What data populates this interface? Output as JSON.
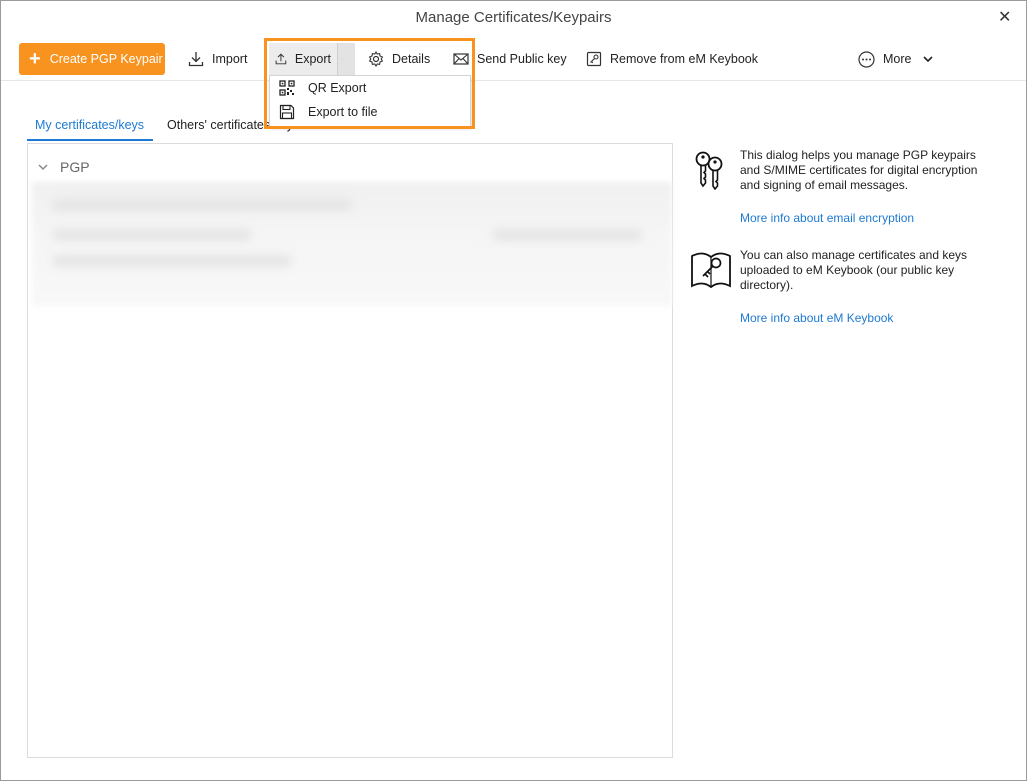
{
  "window": {
    "title": "Manage Certificates/Keypairs",
    "close_label": "✕"
  },
  "toolbar": {
    "create": "Create PGP Keypair",
    "import": "Import",
    "export": "Export",
    "details": "Details",
    "send_public_key": "Send Public key",
    "remove_keybook": "Remove from eM Keybook",
    "more": "More"
  },
  "export_menu": {
    "items": [
      "QR Export",
      "Export to file"
    ]
  },
  "tabs": {
    "mine": "My certificates/keys",
    "others": "Others' certificates/keys"
  },
  "list": {
    "group": "PGP"
  },
  "info": {
    "block1": "This dialog helps you manage PGP keypairs and S/MIME certificates for digital encryption and signing of email messages.",
    "link1": "More info about email encryption",
    "block2": "You can also manage certificates and keys uploaded to eM Keybook (our public key directory).",
    "link2": "More info about eM Keybook"
  },
  "colors": {
    "accent": "#f7931e",
    "link": "#1e7ad2"
  }
}
